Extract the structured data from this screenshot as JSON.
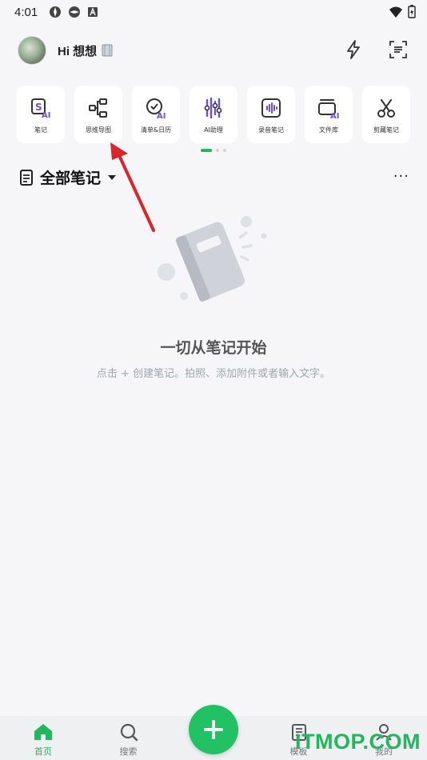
{
  "status_bar": {
    "time": "4:01"
  },
  "header": {
    "greeting": "Hi 想想"
  },
  "tools": [
    {
      "label": "笔记",
      "icon": "ai-note-icon"
    },
    {
      "label": "思维导图",
      "icon": "mindmap-icon"
    },
    {
      "label": "清单&日历",
      "icon": "checklist-ai-icon"
    },
    {
      "label": "AI助理",
      "icon": "ai-assistant-icon"
    },
    {
      "label": "录音笔记",
      "icon": "voice-record-icon"
    },
    {
      "label": "文件库",
      "icon": "file-library-icon"
    },
    {
      "label": "剪藏笔记",
      "icon": "clip-note-icon"
    }
  ],
  "notes": {
    "title": "全部笔记",
    "more": "···"
  },
  "empty_state": {
    "title": "一切从笔记开始",
    "subtitle": "点击 + 创建笔记。拍照、添加附件或者输入文字。"
  },
  "bottom_nav": {
    "home": "首页",
    "search": "搜索",
    "templates": "模板",
    "mine": "我的"
  },
  "watermark": "ITMOP.COM",
  "colors": {
    "accent": "#22b65d",
    "fab": "#22c164",
    "annotation_arrow": "#d9262c"
  }
}
